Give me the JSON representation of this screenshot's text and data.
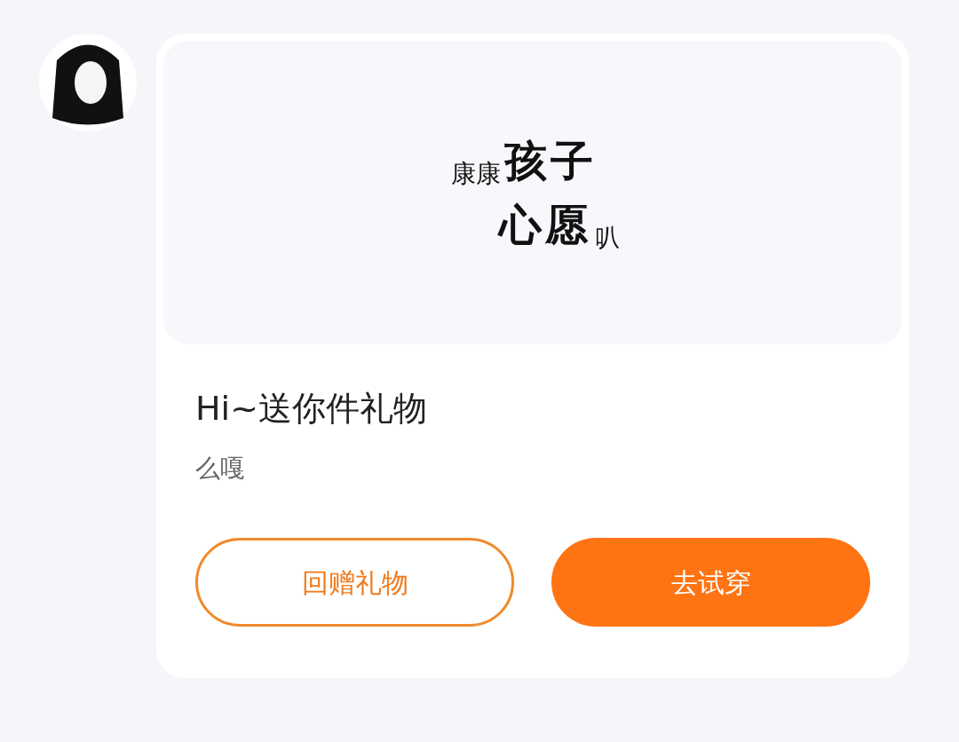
{
  "gift_card": {
    "image_text": [
      {
        "text": "康康",
        "kind": "small"
      },
      {
        "text": "孩子",
        "kind": "large"
      },
      {
        "text": "心愿",
        "kind": "large"
      },
      {
        "text": "叭",
        "kind": "small"
      }
    ],
    "title": "Hi~送你件礼物",
    "subtitle": "么嘎",
    "buttons": [
      {
        "label": "回赠礼物",
        "kind": "outline"
      },
      {
        "label": "去试穿",
        "kind": "filled"
      }
    ]
  }
}
